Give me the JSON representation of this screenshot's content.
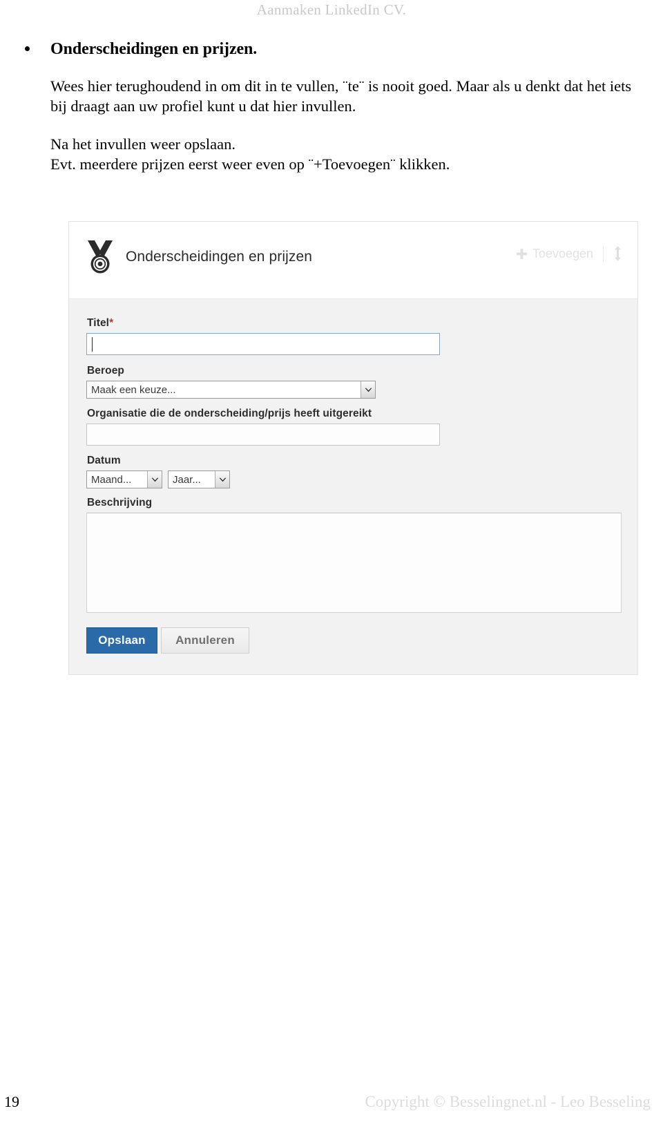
{
  "running_head": "Aanmaken LinkedIn CV.",
  "content": {
    "bullet_heading": "Onderscheidingen en prijzen.",
    "paragraph_1": "Wees hier terughoudend in om dit in te vullen, ¨te¨ is nooit goed. Maar als u denkt dat het iets bij draagt aan uw profiel kunt u dat hier invullen.",
    "paragraph_2_line_1": "Na het invullen weer opslaan.",
    "paragraph_2_line_2": "Evt. meerdere prijzen eerst weer even op ¨+Toevoegen¨ klikken."
  },
  "screenshot": {
    "header": {
      "icon": "medal-icon",
      "title": "Onderscheidingen en prijzen",
      "add_label": "Toevoegen",
      "add_icon": "plus-icon",
      "reorder_icon": "reorder-updown-icon"
    },
    "form": {
      "titel": {
        "label": "Titel",
        "required_marker": "*",
        "value": ""
      },
      "beroep": {
        "label": "Beroep",
        "selected": "Maak een keuze..."
      },
      "organisatie": {
        "label": "Organisatie die de onderscheiding/prijs heeft uitgereikt",
        "value": ""
      },
      "datum": {
        "label": "Datum",
        "maand_selected": "Maand...",
        "jaar_selected": "Jaar..."
      },
      "beschrijving": {
        "label": "Beschrijving",
        "value": ""
      },
      "buttons": {
        "save": "Opslaan",
        "cancel": "Annuleren"
      }
    }
  },
  "footer": {
    "page_number": "19",
    "copyright": "Copyright © Besselingnet.nl -  Leo Besseling"
  },
  "colors": {
    "primary_button": "#2a6aa8",
    "required_star": "#b43c3c",
    "muted_text": "#e2e2e2",
    "footer_text": "#dcdcdc"
  }
}
